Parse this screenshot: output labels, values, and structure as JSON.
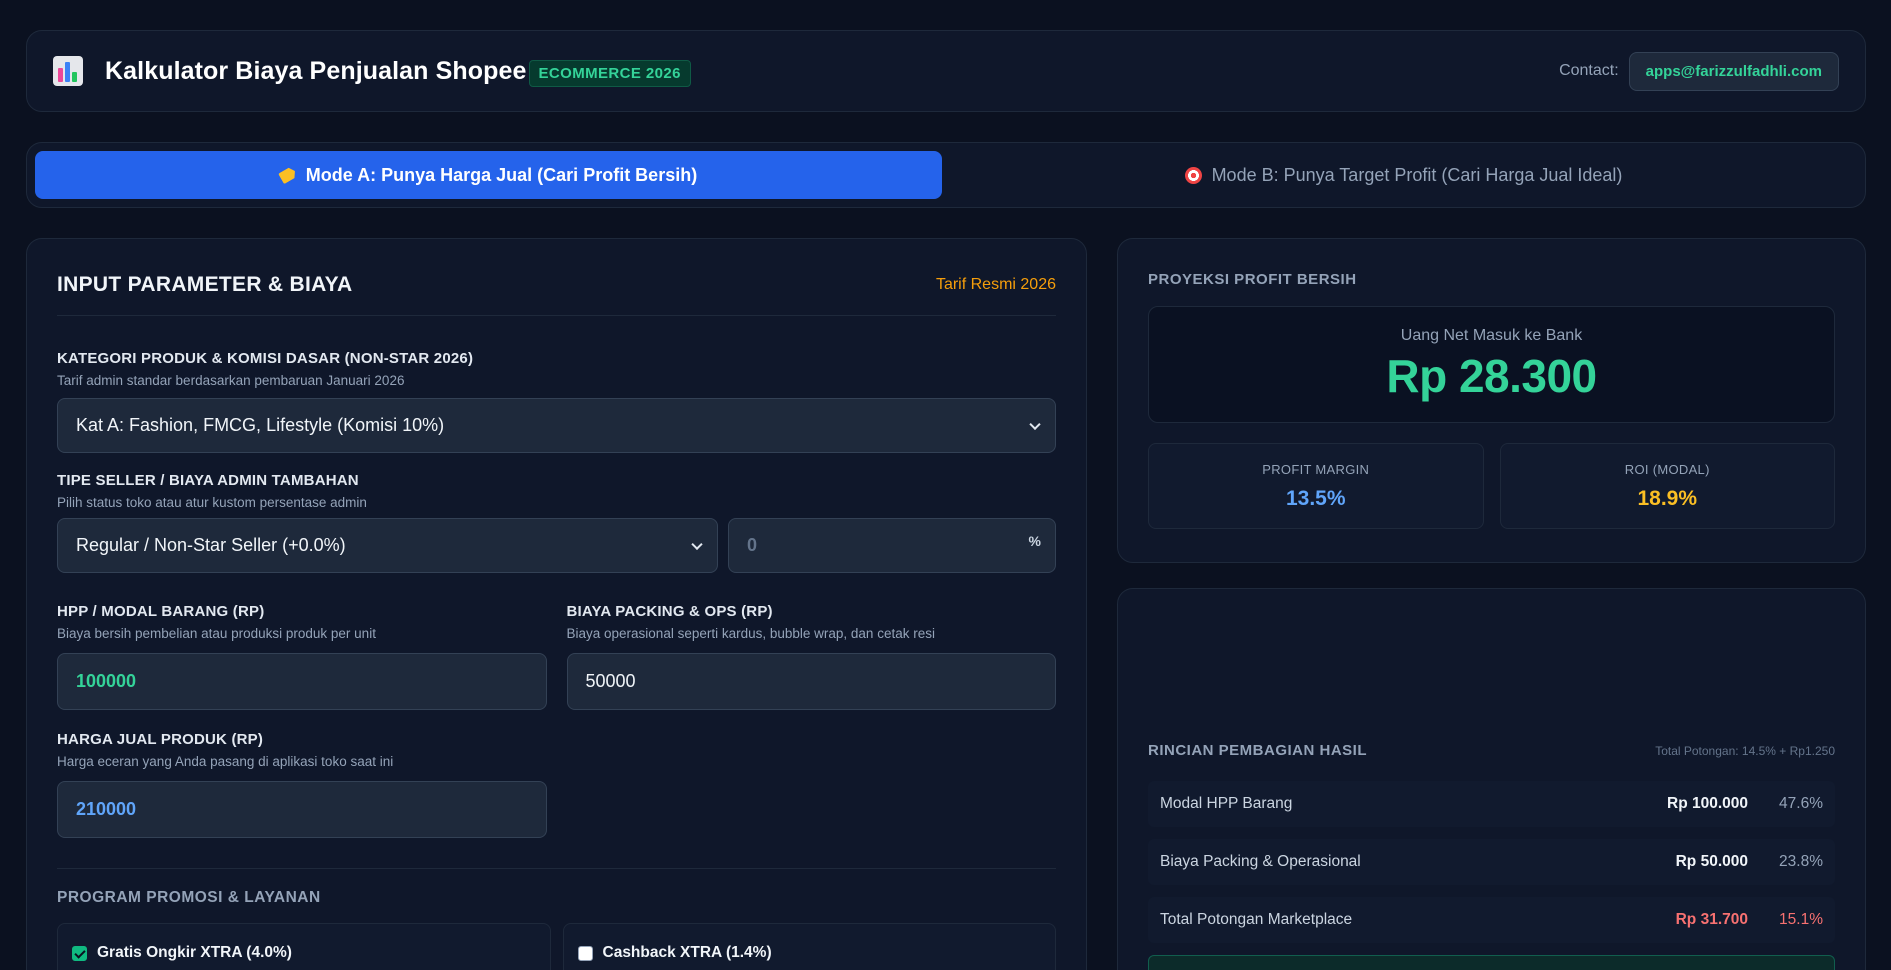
{
  "header": {
    "title": "Kalkulator Biaya Penjualan Shopee",
    "badge": "ECOMMERCE 2026",
    "contact_label": "Contact:",
    "contact_email": "apps@farizzulfadhli.com"
  },
  "tabs": [
    {
      "label": "Mode A: Punya Harga Jual (Cari Profit Bersih)",
      "icon": "tag-icon",
      "active": true
    },
    {
      "label": "Mode B: Punya Target Profit (Cari Harga Jual Ideal)",
      "icon": "target-icon",
      "active": false
    }
  ],
  "input_panel": {
    "title": "INPUT PARAMETER & BIAYA",
    "tarif": "Tarif Resmi 2026",
    "category": {
      "label": "KATEGORI PRODUK & KOMISI DASAR (NON-STAR 2026)",
      "help": "Tarif admin standar berdasarkan pembaruan Januari 2026",
      "value": "Kat A: Fashion, FMCG, Lifestyle (Komisi 10%)"
    },
    "seller": {
      "label": "TIPE SELLER / BIAYA ADMIN TAMBAHAN",
      "help": "Pilih status toko atau atur kustom persentase admin",
      "value": "Regular / Non-Star Seller (+0.0%)",
      "custom_placeholder": "0",
      "unit": "%"
    },
    "hpp": {
      "label": "HPP / MODAL BARANG (RP)",
      "help": "Biaya bersih pembelian atau produksi produk per unit",
      "value": "100000"
    },
    "packing": {
      "label": "BIAYA PACKING & OPS (RP)",
      "help": "Biaya operasional seperti kardus, bubble wrap, dan cetak resi",
      "value": "50000"
    },
    "price": {
      "label": "HARGA JUAL PRODUK (RP)",
      "help": "Harga eceran yang Anda pasang di aplikasi toko saat ini",
      "value": "210000"
    },
    "promo": {
      "title": "PROGRAM PROMOSI & LAYANAN",
      "items": [
        {
          "label": "Gratis Ongkir XTRA (4.0%)",
          "checked": true
        },
        {
          "label": "Cashback XTRA (1.4%)",
          "checked": false
        }
      ]
    }
  },
  "projection": {
    "title": "PROYEKSI PROFIT BERSIH",
    "net_label": "Uang Net Masuk ke Bank",
    "net_value": "Rp 28.300",
    "margin_label": "PROFIT MARGIN",
    "margin_value": "13.5%",
    "roi_label": "ROI (MODAL)",
    "roi_value": "18.9%",
    "colors": {
      "margin": "#60a5fa",
      "roi": "#fbbf24",
      "net": "#34d399"
    }
  },
  "split": {
    "title": "RINCIAN PEMBAGIAN HASIL",
    "total": "Total Potongan: 14.5% + Rp1.250",
    "rows": [
      {
        "label": "Modal HPP Barang",
        "amount": "Rp 100.000",
        "pct": "47.6%"
      },
      {
        "label": "Biaya Packing & Operasional",
        "amount": "Rp 50.000",
        "pct": "23.8%"
      },
      {
        "label": "Total Potongan Marketplace",
        "amount": "Rp 31.700",
        "pct": "15.1%"
      }
    ]
  }
}
